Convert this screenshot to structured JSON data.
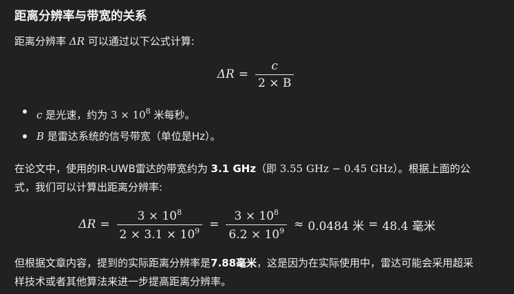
{
  "heading": "距离分辨率与带宽的关系",
  "intro": {
    "prefix": "距离分辨率 ",
    "delta_r": "ΔR",
    "suffix": " 可以通过以下公式计算:"
  },
  "formula1": {
    "lhs": "ΔR",
    "eq": "=",
    "num": "c",
    "den": "2 × B"
  },
  "bullets": [
    {
      "var": "c",
      "text_a": " 是光速，约为 ",
      "math": "3 × 10",
      "exp": "8",
      "text_b": " 米每秒。"
    },
    {
      "var": "B",
      "text_a": " 是雷达系统的信号带宽（单位是Hz）。"
    }
  ],
  "para2": {
    "line1_a": "在论文中，使用的IR-UWB雷达的带宽约为 ",
    "bw_bold": "3.1 GHz",
    "line1_b": "（即 ",
    "math": "3.55 GHz − 0.45 GHz",
    "line1_c": "）。根据上面的公",
    "line2": "式，我们可以计算出距离分辨率:"
  },
  "formula2": {
    "lhs": "ΔR",
    "eq": "=",
    "f1_num": "3 × 10",
    "f1_num_exp": "8",
    "f1_den": "2 × 3.1 × 10",
    "f1_den_exp": "9",
    "f2_num": "3 × 10",
    "f2_num_exp": "8",
    "f2_den": "6.2 × 10",
    "f2_den_exp": "9",
    "approx": "≈",
    "val1": "0.0484 米",
    "eq2": "=",
    "val2": "48.4 毫米"
  },
  "para3": {
    "line1_a": "但根据文章内容，提到的实际距离分辨率是",
    "res_bold": "7.88毫米",
    "line1_b": "，这是因为在实际使用中，雷达可能会采用超采",
    "line2": "样技术或者其他算法来进一步提高距离分辨率。"
  }
}
